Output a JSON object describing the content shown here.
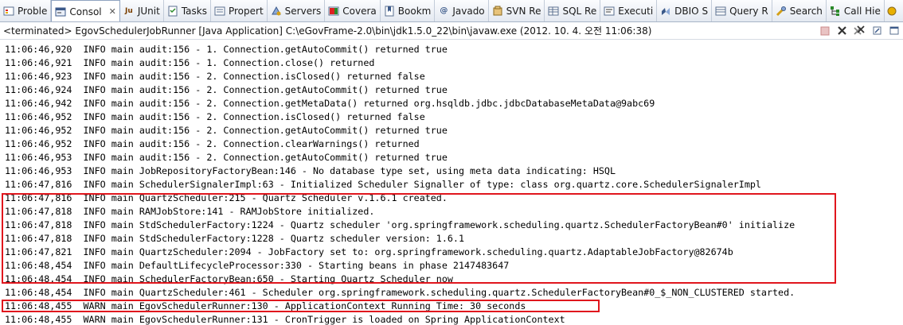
{
  "tabs": [
    {
      "label": "Proble",
      "icon": "problems-icon",
      "active": false
    },
    {
      "label": "Consol",
      "icon": "console-icon",
      "active": true
    },
    {
      "label": "JUnit",
      "icon": "junit-icon",
      "active": false
    },
    {
      "label": "Tasks",
      "icon": "tasks-icon",
      "active": false
    },
    {
      "label": "Propert",
      "icon": "properties-icon",
      "active": false
    },
    {
      "label": "Servers",
      "icon": "servers-icon",
      "active": false
    },
    {
      "label": "Covera",
      "icon": "coverage-icon",
      "active": false
    },
    {
      "label": "Bookm",
      "icon": "bookmarks-icon",
      "active": false
    },
    {
      "label": "Javado",
      "icon": "javadoc-icon",
      "active": false
    },
    {
      "label": "SVN Re",
      "icon": "svn-icon",
      "active": false
    },
    {
      "label": "SQL Re",
      "icon": "sql-results-icon",
      "active": false
    },
    {
      "label": "Executi",
      "icon": "execution-icon",
      "active": false
    },
    {
      "label": "DBIO S",
      "icon": "dbio-icon",
      "active": false
    },
    {
      "label": "Query R",
      "icon": "query-icon",
      "active": false
    },
    {
      "label": "Search",
      "icon": "search-icon",
      "active": false
    },
    {
      "label": "Call Hie",
      "icon": "call-hierarchy-icon",
      "active": false
    }
  ],
  "status": "<terminated> EgovSchedulerJobRunner [Java Application] C:\\eGovFrame-2.0\\bin\\jdk1.5.0_22\\bin\\javaw.exe (2012. 10. 4. 오전 11:06:38)",
  "toolbar_icons": [
    "terminate-icon",
    "remove-launch-icon",
    "remove-all-icon",
    "pin-console-icon",
    "display-console-icon"
  ],
  "colors": {
    "highlight_border": "#e0161d"
  },
  "console_lines": [
    "11:06:46,920  INFO main audit:156 - 1. Connection.getAutoCommit() returned true",
    "11:06:46,921  INFO main audit:156 - 1. Connection.close() returned",
    "11:06:46,923  INFO main audit:156 - 2. Connection.isClosed() returned false",
    "11:06:46,924  INFO main audit:156 - 2. Connection.getAutoCommit() returned true",
    "11:06:46,942  INFO main audit:156 - 2. Connection.getMetaData() returned org.hsqldb.jdbc.jdbcDatabaseMetaData@9abc69",
    "11:06:46,952  INFO main audit:156 - 2. Connection.isClosed() returned false",
    "11:06:46,952  INFO main audit:156 - 2. Connection.getAutoCommit() returned true",
    "11:06:46,952  INFO main audit:156 - 2. Connection.clearWarnings() returned",
    "11:06:46,953  INFO main audit:156 - 2. Connection.getAutoCommit() returned true",
    "11:06:46,953  INFO main JobRepositoryFactoryBean:146 - No database type set, using meta data indicating: HSQL",
    "11:06:47,816  INFO main SchedulerSignalerImpl:63 - Initialized Scheduler Signaller of type: class org.quartz.core.SchedulerSignalerImpl",
    "11:06:47,816  INFO main QuartzScheduler:215 - Quartz Scheduler v.1.6.1 created.",
    "11:06:47,818  INFO main RAMJobStore:141 - RAMJobStore initialized.",
    "11:06:47,818  INFO main StdSchedulerFactory:1224 - Quartz scheduler 'org.springframework.scheduling.quartz.SchedulerFactoryBean#0' initialize",
    "11:06:47,818  INFO main StdSchedulerFactory:1228 - Quartz scheduler version: 1.6.1",
    "11:06:47,821  INFO main QuartzScheduler:2094 - JobFactory set to: org.springframework.scheduling.quartz.AdaptableJobFactory@82674b",
    "11:06:48,454  INFO main DefaultLifecycleProcessor:330 - Starting beans in phase 2147483647",
    "11:06:48,454  INFO main SchedulerFactoryBean:650 - Starting Quartz Scheduler now",
    "11:06:48,454  INFO main QuartzScheduler:461 - Scheduler org.springframework.scheduling.quartz.SchedulerFactoryBean#0_$_NON_CLUSTERED started.",
    "11:06:48,455  WARN main EgovSchedulerRunner:130 - ApplicationContext Running Time: 30 seconds",
    "11:06:48,455  WARN main EgovSchedulerRunner:131 - CronTrigger is loaded on Spring ApplicationContext"
  ]
}
